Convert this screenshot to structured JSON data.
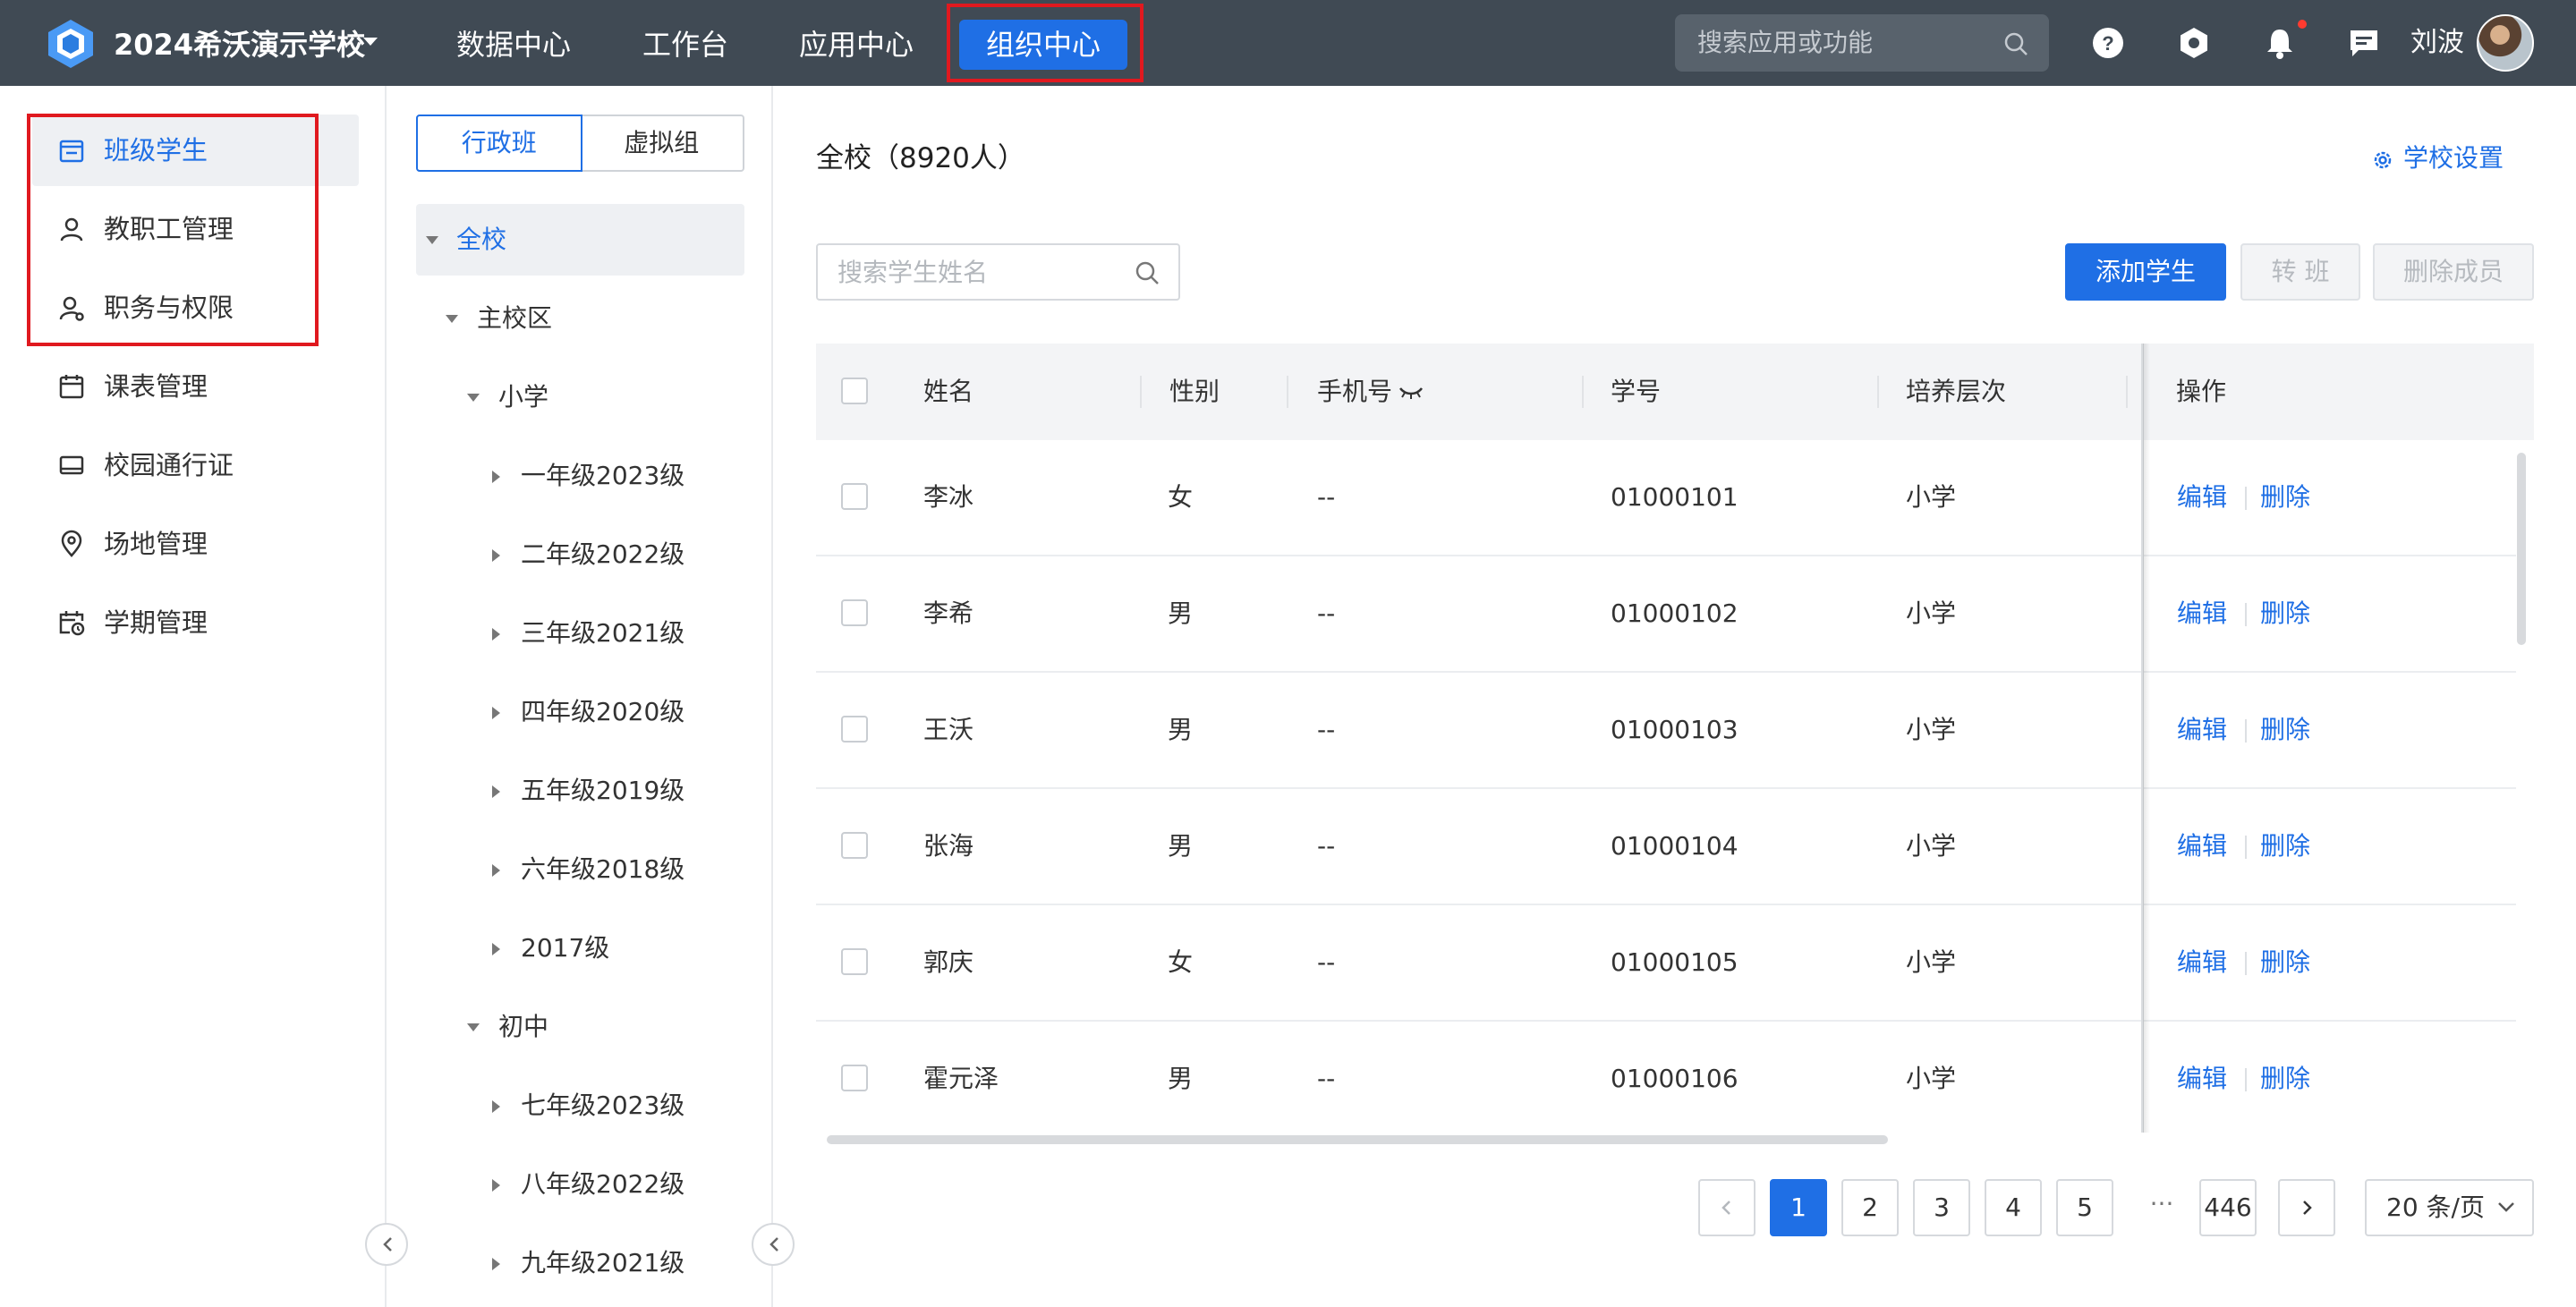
{
  "header": {
    "school_name": "2024希沃演示学校",
    "nav": [
      "数据中心",
      "工作台",
      "应用中心",
      "组织中心"
    ],
    "active_nav": "组织中心",
    "search_placeholder": "搜索应用或功能",
    "user_name": "刘波",
    "accent_color": "#1f6fe5",
    "bar_color": "#404a54"
  },
  "sidebar": {
    "items": [
      {
        "label": "班级学生",
        "icon": "class-icon",
        "active": true
      },
      {
        "label": "教职工管理",
        "icon": "user-icon"
      },
      {
        "label": "职务与权限",
        "icon": "user-permission-icon"
      },
      {
        "label": "课表管理",
        "icon": "calendar-icon"
      },
      {
        "label": "校园通行证",
        "icon": "card-icon"
      },
      {
        "label": "场地管理",
        "icon": "location-icon"
      },
      {
        "label": "学期管理",
        "icon": "calendar-clock-icon"
      }
    ]
  },
  "tree": {
    "tabs": [
      "行政班",
      "虚拟组"
    ],
    "nodes": [
      {
        "label": "全校",
        "expanded": true,
        "selected": true
      },
      {
        "label": "主校区",
        "expanded": true
      },
      {
        "label": "小学",
        "expanded": true
      },
      {
        "label": "一年级2023级"
      },
      {
        "label": "二年级2022级"
      },
      {
        "label": "三年级2021级"
      },
      {
        "label": "四年级2020级"
      },
      {
        "label": "五年级2019级"
      },
      {
        "label": "六年级2018级"
      },
      {
        "label": "2017级"
      },
      {
        "label": "初中",
        "expanded": true
      },
      {
        "label": "七年级2023级"
      },
      {
        "label": "八年级2022级"
      },
      {
        "label": "九年级2021级"
      }
    ]
  },
  "main": {
    "title": "全校（8920人）",
    "settings_label": "学校设置",
    "search_placeholder": "搜索学生姓名",
    "buttons": {
      "add": "添加学生",
      "transfer": "转 班",
      "remove": "删除成员"
    },
    "columns": [
      "姓名",
      "性别",
      "手机号",
      "学号",
      "培养层次",
      "操作"
    ],
    "rows": [
      {
        "name": "李冰",
        "gender": "女",
        "phone": "--",
        "id": "01000101",
        "level": "小学"
      },
      {
        "name": "李希",
        "gender": "男",
        "phone": "--",
        "id": "01000102",
        "level": "小学"
      },
      {
        "name": "王沃",
        "gender": "男",
        "phone": "--",
        "id": "01000103",
        "level": "小学"
      },
      {
        "name": "张海",
        "gender": "男",
        "phone": "--",
        "id": "01000104",
        "level": "小学"
      },
      {
        "name": "郭庆",
        "gender": "女",
        "phone": "--",
        "id": "01000105",
        "level": "小学"
      },
      {
        "name": "霍元泽",
        "gender": "男",
        "phone": "--",
        "id": "01000106",
        "level": "小学"
      }
    ],
    "actions": {
      "edit": "编辑",
      "delete": "删除"
    }
  },
  "pagination": {
    "pages": [
      "1",
      "2",
      "3",
      "4",
      "5"
    ],
    "ellipsis": "···",
    "last_page": "446",
    "current": "1",
    "page_size": "20 条/页"
  }
}
